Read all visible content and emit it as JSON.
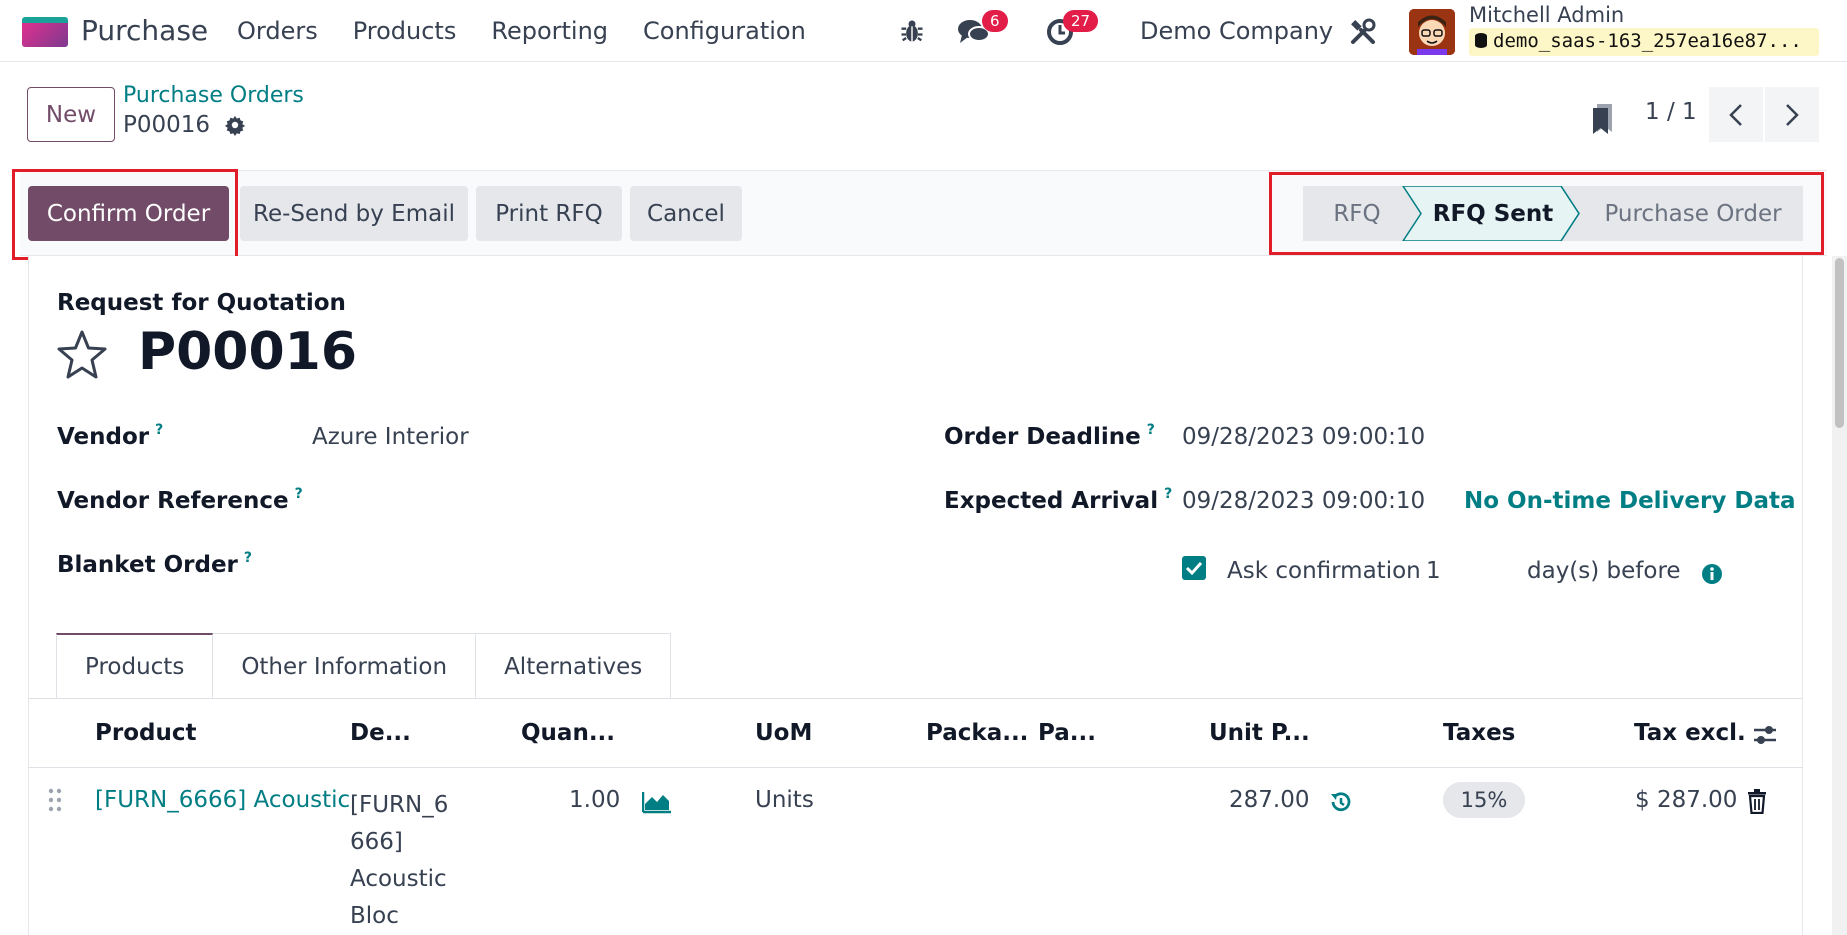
{
  "navbar": {
    "app_name": "Purchase",
    "menu": [
      "Orders",
      "Products",
      "Reporting",
      "Configuration"
    ],
    "messages_count": "6",
    "activities_count": "27",
    "company": "Demo Company",
    "user_name": "Mitchell Admin",
    "database": "demo_saas-163_257ea16e87..."
  },
  "control": {
    "new_label": "New",
    "breadcrumb_parent": "Purchase Orders",
    "breadcrumb_current": "P00016",
    "pager": "1 / 1"
  },
  "actions": {
    "confirm": "Confirm Order",
    "resend": "Re-Send by Email",
    "print": "Print RFQ",
    "cancel": "Cancel"
  },
  "stages": [
    "RFQ",
    "RFQ Sent",
    "Purchase Order"
  ],
  "form": {
    "doc_type": "Request for Quotation",
    "name": "P00016",
    "vendor_label": "Vendor",
    "vendor_value": "Azure Interior",
    "vendor_ref_label": "Vendor Reference",
    "blanket_label": "Blanket Order",
    "deadline_label": "Order Deadline",
    "deadline_value": "09/28/2023 09:00:10",
    "arrival_label": "Expected Arrival",
    "arrival_value": "09/28/2023 09:00:10",
    "delivery_link": "No On-time Delivery Data",
    "ask_confirmation": "Ask confirmation",
    "ask_days": "1",
    "days_before": "day(s) before",
    "help_mark": "?"
  },
  "tabs": [
    "Products",
    "Other Information",
    "Alternatives"
  ],
  "table": {
    "headers": [
      "Product",
      "De...",
      "Quan...",
      "UoM",
      "Packa...",
      "Pa...",
      "Unit P...",
      "Taxes",
      "Tax excl."
    ],
    "row": {
      "product": "[FURN_6666] Acoustic",
      "description": [
        "[FURN_6",
        "666]",
        "Acoustic",
        "Bloc"
      ],
      "quantity": "1.00",
      "uom": "Units",
      "unit_price": "287.00",
      "tax": "15%",
      "subtotal": "$ 287.00"
    }
  },
  "colors": {
    "primary": "#714b67",
    "link": "#017e84",
    "highlight": "#e11d2a",
    "badge": "#e11d48"
  }
}
